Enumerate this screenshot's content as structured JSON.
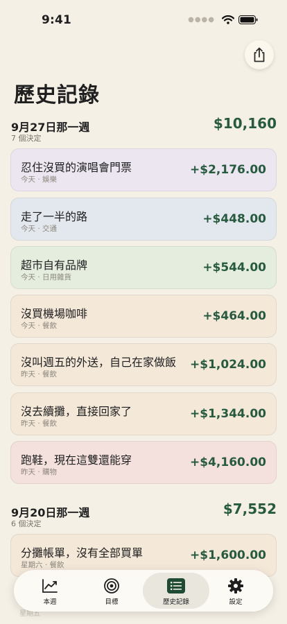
{
  "status": {
    "time": "9:41"
  },
  "page": {
    "title": "歷史記錄"
  },
  "weeks": [
    {
      "title": "9月27日那一週",
      "count": "7 個決定",
      "total": "$10,160",
      "items": [
        {
          "title": "忍住沒買的演唱會門票",
          "sub": "今天 · 娛樂",
          "amount": "+$2,176.00",
          "color": "#ece6f1"
        },
        {
          "title": "走了一半的路",
          "sub": "今天 · 交通",
          "amount": "+$448.00",
          "color": "#e3e8ee"
        },
        {
          "title": "超市自有品牌",
          "sub": "今天 · 日用雜貨",
          "amount": "+$544.00",
          "color": "#e5eddf"
        },
        {
          "title": "沒買機場咖啡",
          "sub": "今天 · 餐飲",
          "amount": "+$464.00",
          "color": "#f4e8d9"
        },
        {
          "title": "沒叫週五的外送，自己在家做飯",
          "sub": "昨天 · 餐飲",
          "amount": "+$1,024.00",
          "color": "#f4e8d9"
        },
        {
          "title": "沒去續攤，直接回家了",
          "sub": "昨天 · 餐飲",
          "amount": "+$1,344.00",
          "color": "#f4e8d9"
        },
        {
          "title": "跑鞋，現在這雙還能穿",
          "sub": "昨天 · 購物",
          "amount": "+$4,160.00",
          "color": "#f4e1de"
        }
      ]
    },
    {
      "title": "9月20日那一週",
      "count": "6 個決定",
      "total": "$7,552",
      "items": [
        {
          "title": "分攤帳單，沒有全部買單",
          "sub": "星期六 · 餐飲",
          "amount": "+$1,600.00",
          "color": "#f4e8d9"
        }
      ]
    }
  ],
  "faded_label": "星期五",
  "tabs": [
    {
      "label": "本週",
      "icon": "trend-chart-icon"
    },
    {
      "label": "目標",
      "icon": "target-icon"
    },
    {
      "label": "歷史記錄",
      "icon": "history-list-icon",
      "active": true
    },
    {
      "label": "設定",
      "icon": "gear-icon"
    }
  ],
  "colors": {
    "accent": "#275a3f",
    "background": "#f5f0e6"
  }
}
